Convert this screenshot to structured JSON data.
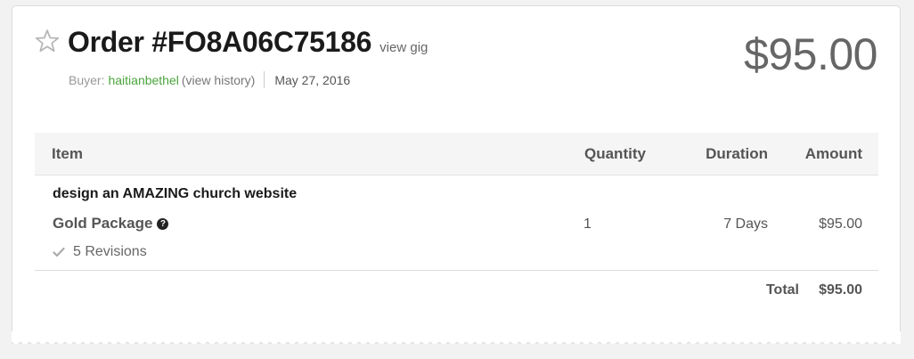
{
  "order": {
    "title": "Order #FO8A06C75186",
    "view_gig": "view gig",
    "price": "$95.00"
  },
  "meta": {
    "buyer_label": "Buyer:",
    "buyer_name": "haitianbethel",
    "history_link": "(view history)",
    "date": "May 27, 2016"
  },
  "table": {
    "headers": {
      "item": "Item",
      "quantity": "Quantity",
      "duration": "Duration",
      "amount": "Amount"
    },
    "rows": [
      {
        "item_name": "design an AMAZING church website",
        "package": "Gold Package",
        "revisions": "5 Revisions",
        "quantity": "1",
        "duration": "7 Days",
        "amount": "$95.00"
      }
    ],
    "total_label": "Total",
    "total_value": "$95.00"
  },
  "icons": {
    "star": "star-outline-icon",
    "help": "question-circle-icon",
    "check": "check-icon"
  },
  "colors": {
    "buyer_link": "#4aa43c",
    "header_bg": "#f5f5f5",
    "price": "#666666"
  }
}
